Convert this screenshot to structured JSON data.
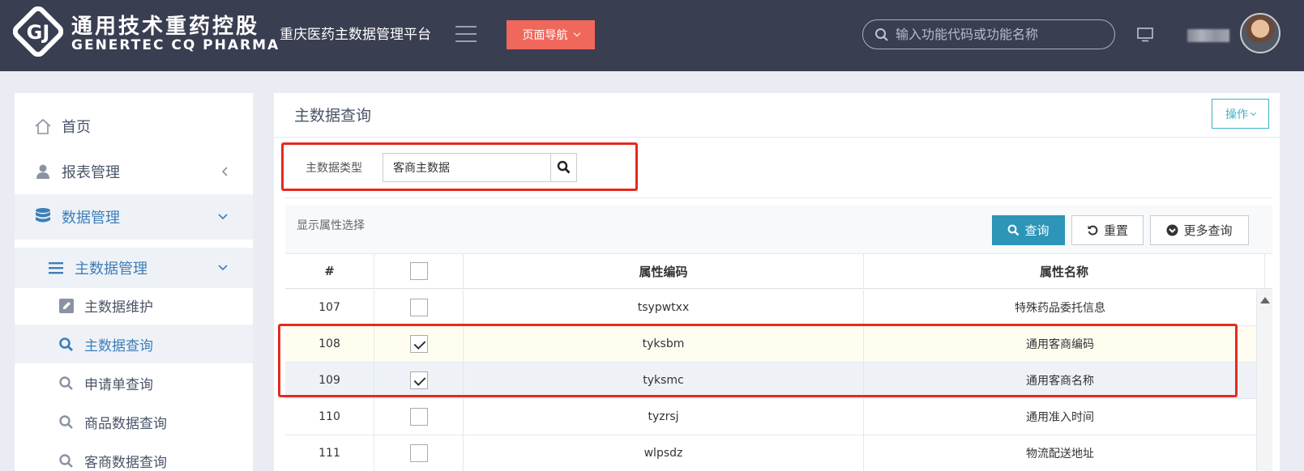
{
  "header": {
    "logo_cn": "通用技术重药控股",
    "logo_en": "GENERTEC CQ PHARMA",
    "app_title": "重庆医药主数据管理平台",
    "nav_button": "页面导航",
    "search_placeholder": "输入功能代码或功能名称"
  },
  "sidebar": {
    "home": "首页",
    "report": "报表管理",
    "data": "数据管理",
    "master": "主数据管理",
    "leaves": [
      "主数据维护",
      "主数据查询",
      "申请单查询",
      "商品数据查询",
      "客商数据查询"
    ]
  },
  "main": {
    "page_title": "主数据查询",
    "op_button": "操作",
    "type_label": "主数据类型",
    "type_value": "客商主数据",
    "attr_title": "显示属性选择",
    "query_btn": "查询",
    "reset_btn": "重置",
    "more_btn": "更多查询"
  },
  "table": {
    "headers": [
      "#",
      "属性编码",
      "属性名称"
    ],
    "rows": [
      {
        "num": "107",
        "code": "tsypwtxx",
        "name": "特殊药品委托信息",
        "checked": false
      },
      {
        "num": "108",
        "code": "tyksbm",
        "name": "通用客商编码",
        "checked": true
      },
      {
        "num": "109",
        "code": "tyksmc",
        "name": "通用客商名称",
        "checked": true
      },
      {
        "num": "110",
        "code": "tyzrsj",
        "name": "通用准入时间",
        "checked": false
      },
      {
        "num": "111",
        "code": "wlpsdz",
        "name": "物流配送地址",
        "checked": false
      }
    ]
  },
  "colors": {
    "header_bg": "#393e51",
    "nav_btn": "#f0685b",
    "primary_btn": "#2d95b8",
    "accent": "#3d7eb8",
    "annotation_red": "#e52a1f"
  }
}
